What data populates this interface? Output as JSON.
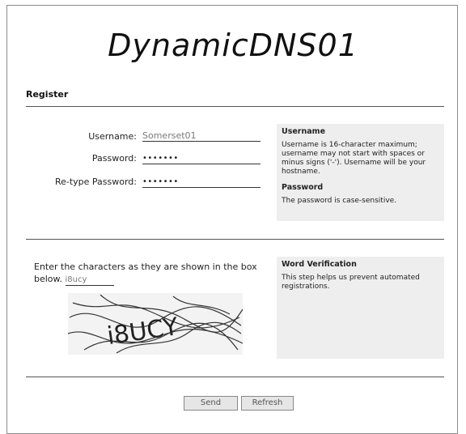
{
  "logo": {
    "text": "DynamicDNS01"
  },
  "register": {
    "title": "Register",
    "username_label": "Username:",
    "username_value": "Somerset01",
    "password_label": "Password:",
    "password_value": "•••••••",
    "retype_label": "Re-type Password:",
    "retype_value": "•••••••"
  },
  "help": {
    "username_heading": "Username",
    "username_text": "Username is 16-character maximum; username may not start with spaces or minus signs ('-'). Username will be your hostname.",
    "password_heading": "Password",
    "password_text": "The password is case-sensitive."
  },
  "verification": {
    "prompt": "Enter the characters as they are shown in the box below.",
    "input_value": "i8ucy",
    "captcha_text": "i8UCY",
    "heading": "Word Verification",
    "help_text": "This step helps us prevent automated registrations."
  },
  "buttons": {
    "send": "Send",
    "refresh": "Refresh"
  }
}
